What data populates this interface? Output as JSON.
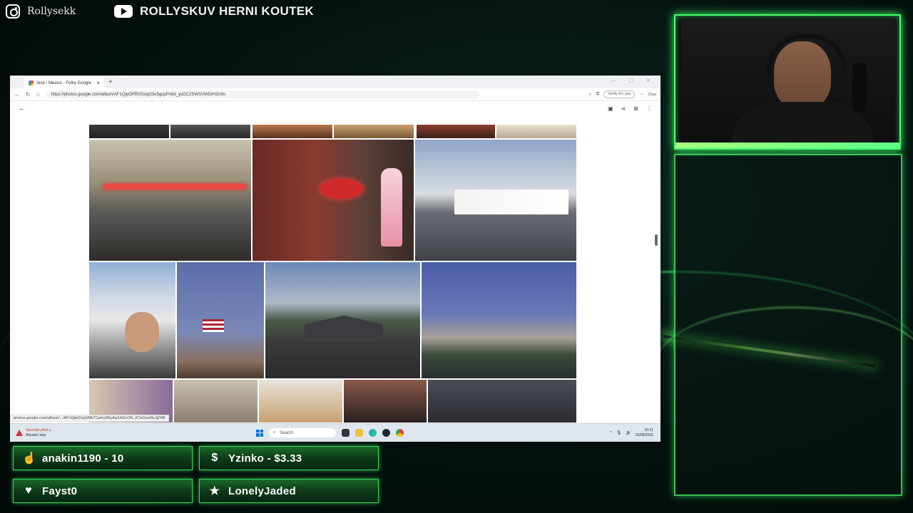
{
  "overlay": {
    "instagram_handle": "Rollysekk",
    "stream_title": "ROLLYSKUV HERNI KOUTEK"
  },
  "browser": {
    "tab_title": "Aine / Mexico - Fotky Google",
    "url": "https://photos.google.com/album/AF1QipOPBVGoqO3o5gcpPn8d_yxGC2SWSVWDrHZn9o",
    "verify_label": "Verify it's you",
    "chat_label": "Chat",
    "status_url": "photos.google.com/album/.../AF1QipO1qGMk7Cwhc0t6yAqXADvON_K7aOcwNvJjZAB"
  },
  "taskbar": {
    "warning_title": "Varování před v...",
    "warning_sub": "Aktuální stav",
    "search_placeholder": "Search",
    "time": "20:31",
    "date": "02/08/2026"
  },
  "alerts": [
    {
      "icon": "hand-icon",
      "text": "anakin1190 - 10"
    },
    {
      "icon": "dollar-icon",
      "text": "Yzinko - $3.33"
    },
    {
      "icon": "heart-icon",
      "text": "Fayst0"
    },
    {
      "icon": "star-icon",
      "text": "LonelyJaded"
    }
  ],
  "colors": {
    "accent": "#43ff6a",
    "badge_dark": "#062510"
  }
}
